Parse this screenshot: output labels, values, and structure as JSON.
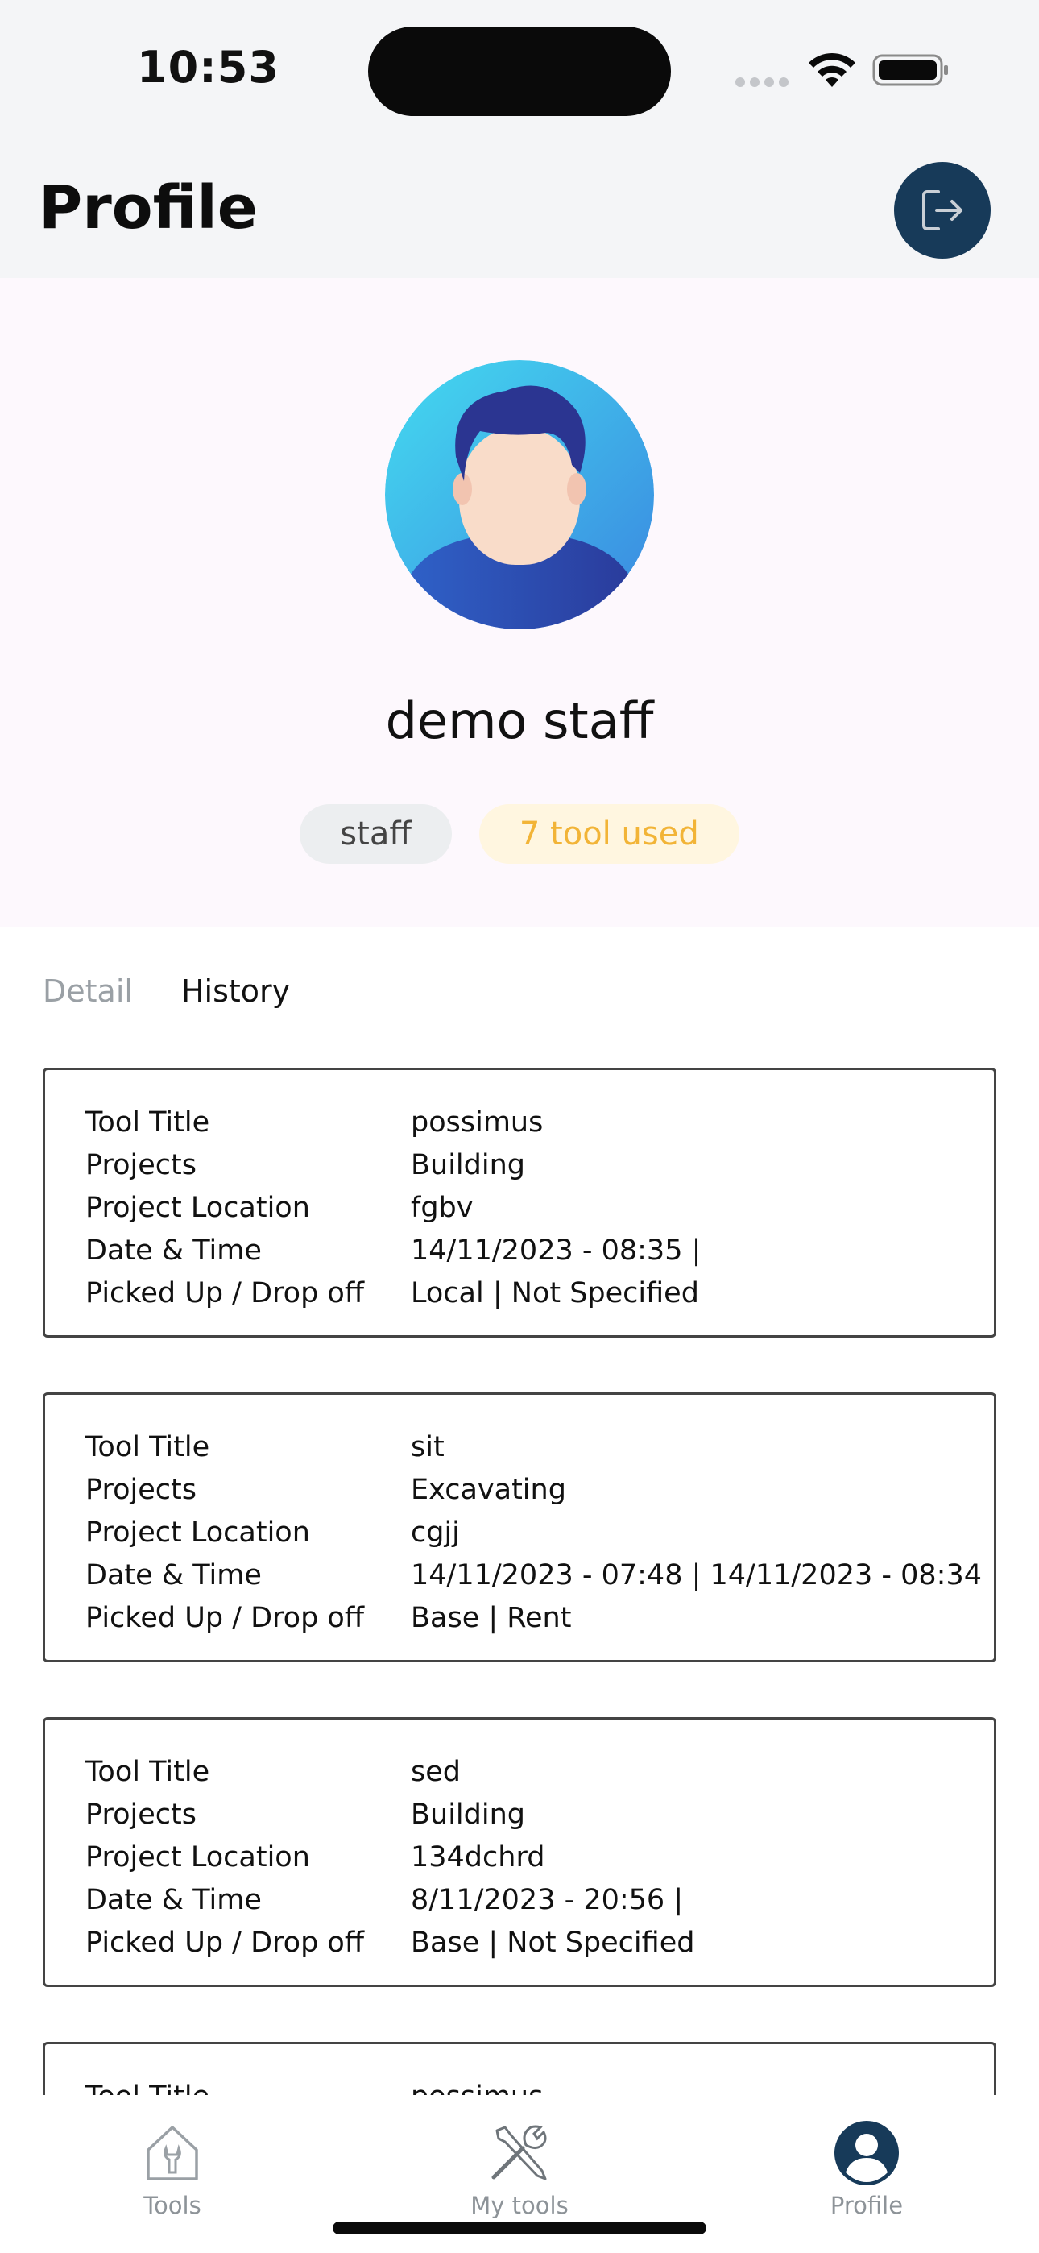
{
  "status_bar": {
    "time": "10:53"
  },
  "header": {
    "title": "Profile"
  },
  "profile": {
    "name": "demo staff",
    "role": "staff",
    "tools_used": "7 tool used"
  },
  "tabs": [
    {
      "label": "Detail",
      "active": false
    },
    {
      "label": "History",
      "active": true
    }
  ],
  "history_labels": {
    "tool_title": "Tool Title",
    "projects": "Projects",
    "project_location": "Project Location",
    "date_time": "Date & Time",
    "picked_drop": "Picked Up / Drop off"
  },
  "history": [
    {
      "tool_title": "possimus",
      "projects": "Building",
      "project_location": "fgbv",
      "date_time": "14/11/2023 - 08:35 |",
      "picked_drop": "Local | Not Specified"
    },
    {
      "tool_title": "sit",
      "projects": "Excavating",
      "project_location": "cgjj",
      "date_time": "14/11/2023 - 07:48 | 14/11/2023 - 08:34",
      "picked_drop": "Base | Rent"
    },
    {
      "tool_title": "sed",
      "projects": "Building",
      "project_location": "134dchrd",
      "date_time": "8/11/2023 - 20:56 |",
      "picked_drop": "Base | Not Specified"
    },
    {
      "tool_title": "possimus",
      "projects": "",
      "project_location": "",
      "date_time": "",
      "picked_drop": ""
    }
  ],
  "bottom_nav": [
    {
      "label": "Tools",
      "icon": "tools-home-icon",
      "active": false
    },
    {
      "label": "My tools",
      "icon": "wrench-screwdriver-icon",
      "active": false
    },
    {
      "label": "Profile",
      "icon": "user-circle-icon",
      "active": true
    }
  ],
  "colors": {
    "accent": "#173a59",
    "tools_chip_text": "#f2b437",
    "tools_chip_bg": "#fff6e0",
    "role_chip_bg": "#eceef0"
  }
}
